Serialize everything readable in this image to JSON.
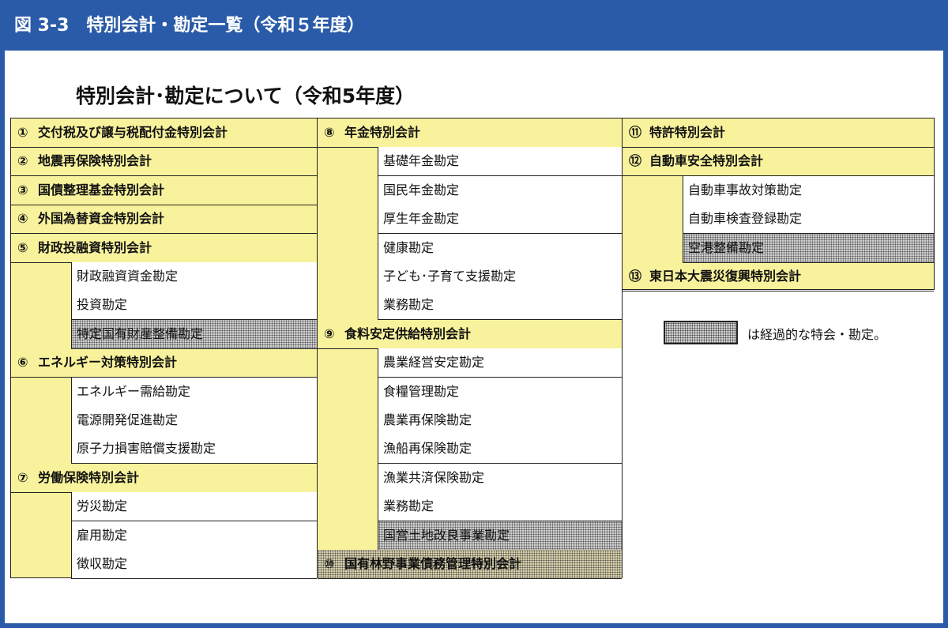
{
  "header": {
    "title": "図 3-3　特別会計・勘定一覧（令和５年度）"
  },
  "subtitle": "特別会計･勘定について（令和5年度）",
  "legend": {
    "text": "は経過的な特会・勘定。"
  },
  "accounts": [
    {
      "id": "a1",
      "num": "①",
      "name": "交付税及び譲与税配付金特別会計",
      "col": 1,
      "row": 0,
      "transitional": false,
      "sub": []
    },
    {
      "id": "a2",
      "num": "②",
      "name": "地震再保険特別会計",
      "col": 1,
      "row": 1,
      "transitional": false,
      "sub": []
    },
    {
      "id": "a3",
      "num": "③",
      "name": "国債整理基金特別会計",
      "col": 1,
      "row": 2,
      "transitional": false,
      "sub": []
    },
    {
      "id": "a4",
      "num": "④",
      "name": "外国為替資金特別会計",
      "col": 1,
      "row": 3,
      "transitional": false,
      "sub": []
    },
    {
      "id": "a5",
      "num": "⑤",
      "name": "財政投融資特別会計",
      "col": 1,
      "row": 4,
      "transitional": false,
      "sub": [
        {
          "name": "財政融資資金勘定",
          "transitional": false
        },
        {
          "name": "投資勘定",
          "transitional": false
        },
        {
          "name": "特定国有財産整備勘定",
          "transitional": true
        }
      ]
    },
    {
      "id": "a6",
      "num": "⑥",
      "name": "エネルギー対策特別会計",
      "col": 1,
      "row": 8,
      "transitional": false,
      "sub": [
        {
          "name": "エネルギー需給勘定",
          "transitional": false
        },
        {
          "name": "電源開発促進勘定",
          "transitional": false
        },
        {
          "name": "原子力損害賠償支援勘定",
          "transitional": false
        }
      ]
    },
    {
      "id": "a7",
      "num": "⑦",
      "name": "労働保険特別会計",
      "col": 1,
      "row": 12,
      "transitional": false,
      "sub": [
        {
          "name": "労災勘定",
          "transitional": false
        },
        {
          "name": "雇用勘定",
          "transitional": false
        },
        {
          "name": "徴収勘定",
          "transitional": false
        }
      ]
    },
    {
      "id": "a8",
      "num": "⑧",
      "name": "年金特別会計",
      "col": 2,
      "row": 0,
      "transitional": false,
      "sub": [
        {
          "name": "基礎年金勘定",
          "transitional": false
        },
        {
          "name": "国民年金勘定",
          "transitional": false
        },
        {
          "name": "厚生年金勘定",
          "transitional": false
        },
        {
          "name": "健康勘定",
          "transitional": false
        },
        {
          "name": "子ども･子育て支援勘定",
          "transitional": false
        },
        {
          "name": "業務勘定",
          "transitional": false
        }
      ]
    },
    {
      "id": "a9",
      "num": "⑨",
      "name": "食料安定供給特別会計",
      "col": 2,
      "row": 7,
      "transitional": false,
      "sub": [
        {
          "name": "農業経営安定勘定",
          "transitional": false
        },
        {
          "name": "食糧管理勘定",
          "transitional": false
        },
        {
          "name": "農業再保険勘定",
          "transitional": false
        },
        {
          "name": "漁船再保険勘定",
          "transitional": false
        },
        {
          "name": "漁業共済保険勘定",
          "transitional": false
        },
        {
          "name": "業務勘定",
          "transitional": false
        },
        {
          "name": "国営土地改良事業勘定",
          "transitional": true
        }
      ]
    },
    {
      "id": "a10",
      "num": "⑩",
      "name": "国有林野事業債務管理特別会計",
      "col": 2,
      "row": 15,
      "transitional": true,
      "sub": []
    },
    {
      "id": "a11",
      "num": "⑪",
      "name": "特許特別会計",
      "col": 3,
      "row": 0,
      "transitional": false,
      "sub": []
    },
    {
      "id": "a12",
      "num": "⑫",
      "name": "自動車安全特別会計",
      "col": 3,
      "row": 1,
      "transitional": false,
      "sub": [
        {
          "name": "自動車事故対策勘定",
          "transitional": false
        },
        {
          "name": "自動車検査登録勘定",
          "transitional": false
        },
        {
          "name": "空港整備勘定",
          "transitional": true
        }
      ]
    },
    {
      "id": "a13",
      "num": "⑬",
      "name": "東日本大震災復興特別会計",
      "col": 3,
      "row": 5,
      "transitional": false,
      "sub": []
    }
  ]
}
